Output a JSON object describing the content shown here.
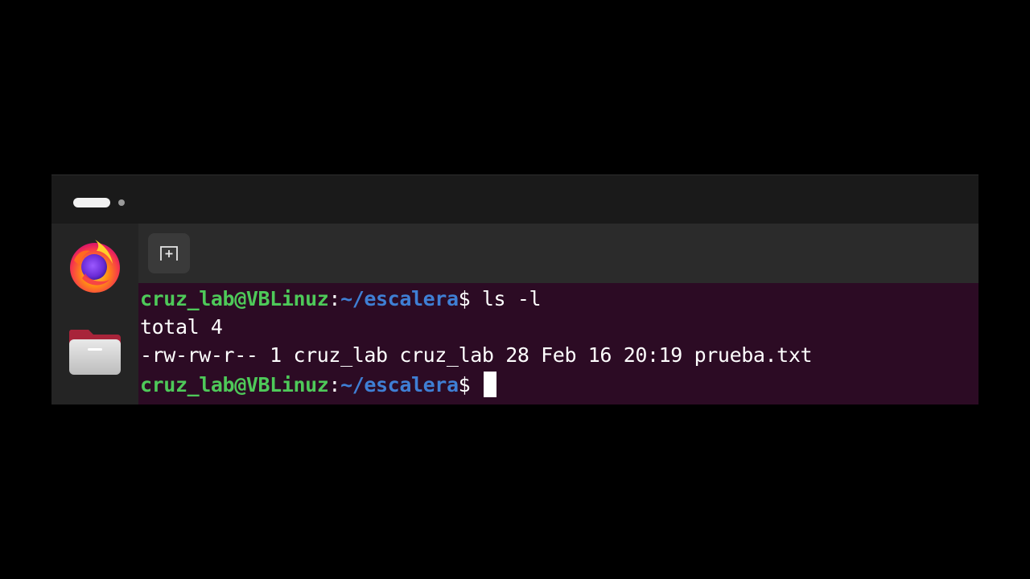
{
  "topbar": {
    "workspaces": [
      "workspace-1",
      "workspace-2"
    ],
    "active_workspace": 1
  },
  "dock": {
    "items": [
      {
        "name": "Firefox",
        "icon": "firefox-icon"
      },
      {
        "name": "Files",
        "icon": "folder-icon"
      }
    ]
  },
  "terminal": {
    "new_tab_icon": "new-tab-icon",
    "colors": {
      "background": "#2c0b24",
      "user_host": "#4ec959",
      "path": "#3f7fd4",
      "text": "#ffffff"
    },
    "lines": [
      {
        "user_host": "cruz_lab@VBLinuz",
        "colon": ":",
        "path": "~/escalera",
        "dollar": "$",
        "command": " ls -l"
      },
      {
        "text": "total 4"
      },
      {
        "text": "-rw-rw-r-- 1 cruz_lab cruz_lab 28 Feb 16 20:19 prueba.txt"
      },
      {
        "user_host": "cruz_lab@VBLinuz",
        "colon": ":",
        "path": "~/escalera",
        "dollar": "$",
        "command": " "
      }
    ]
  }
}
